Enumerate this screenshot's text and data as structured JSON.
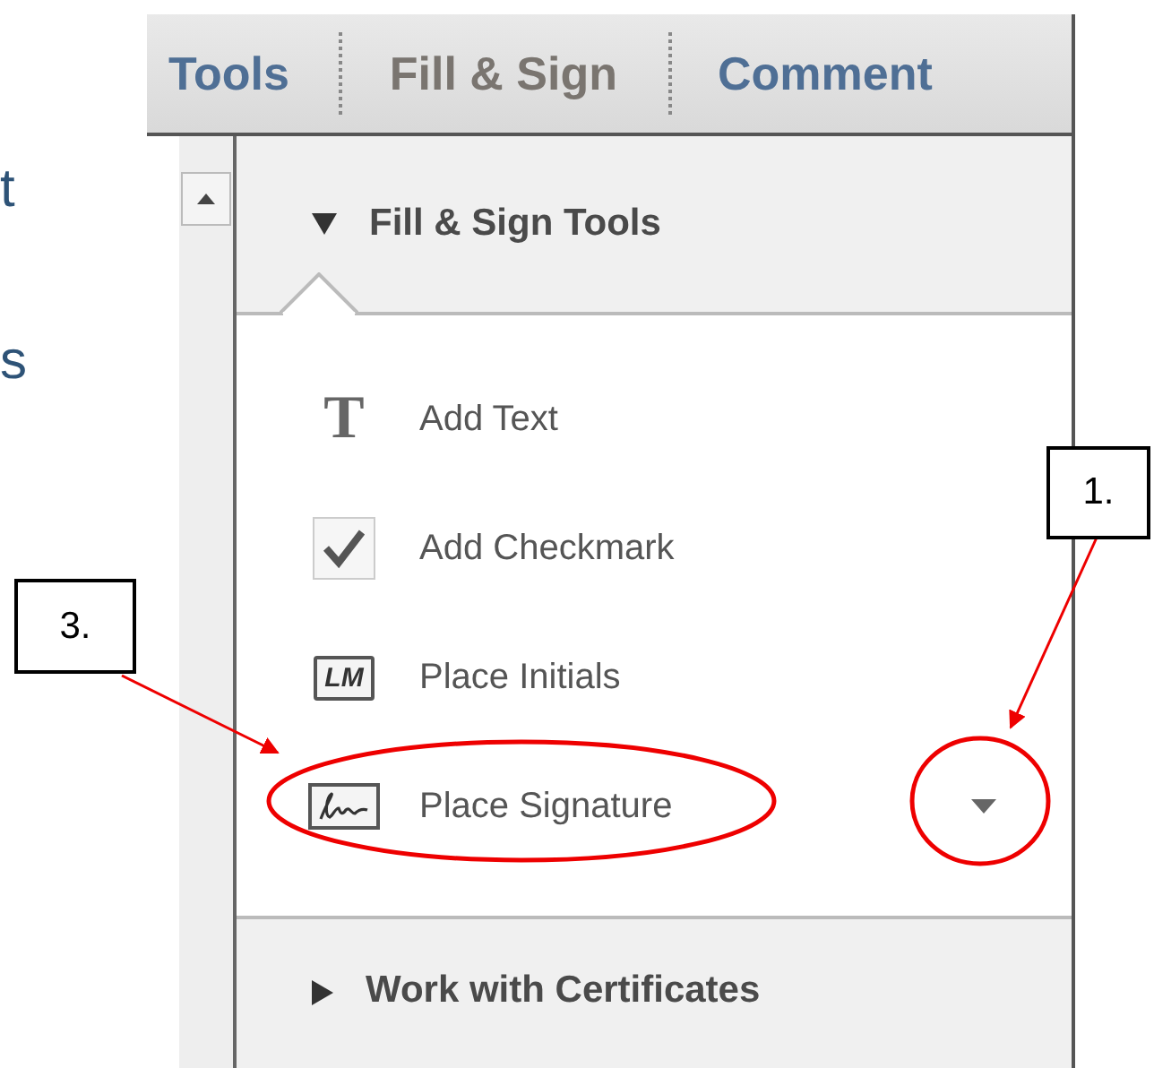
{
  "document": {
    "fragments": [
      "t",
      "s"
    ]
  },
  "tabs": [
    {
      "label": "Tools",
      "selected": false
    },
    {
      "label": "Fill & Sign",
      "selected": true
    },
    {
      "label": "Comment",
      "selected": false
    }
  ],
  "sections": [
    {
      "title": "Fill & Sign Tools",
      "expanded": true,
      "items": [
        {
          "kind": "glyph",
          "glyph": "T",
          "label": "Add Text",
          "menu": false
        },
        {
          "kind": "check",
          "label": "Add Checkmark",
          "menu": false
        },
        {
          "kind": "initials",
          "glyph": "LM",
          "label": "Place Initials",
          "menu": false
        },
        {
          "kind": "signature",
          "label": "Place Signature",
          "menu": true
        }
      ]
    },
    {
      "title": "Work with Certificates",
      "expanded": false
    }
  ],
  "callouts": [
    {
      "label": "1."
    },
    {
      "label": "3."
    }
  ]
}
